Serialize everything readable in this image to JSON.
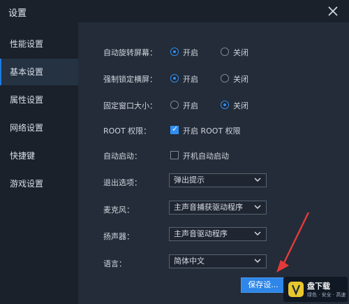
{
  "window": {
    "title": "设置"
  },
  "sidebar": {
    "items": [
      {
        "label": "性能设置"
      },
      {
        "label": "基本设置"
      },
      {
        "label": "属性设置"
      },
      {
        "label": "网络设置"
      },
      {
        "label": "快捷键"
      },
      {
        "label": "游戏设置"
      }
    ],
    "active_index": 1
  },
  "settings": {
    "auto_rotate": {
      "label": "自动旋转屏幕：",
      "on": "开启",
      "off": "关闭",
      "value": "on"
    },
    "force_landscape": {
      "label": "强制锁定横屏：",
      "on": "开启",
      "off": "关闭",
      "value": "on"
    },
    "fixed_window": {
      "label": "固定窗口大小：",
      "on": "开启",
      "off": "关闭",
      "value": "off"
    },
    "root": {
      "label": "ROOT 权限：",
      "option": "开启 ROOT 权限",
      "checked": true
    },
    "autostart": {
      "label": "自动启动：",
      "option": "开机自动启动",
      "checked": false
    },
    "exit_option": {
      "label": "退出选项：",
      "value": "弹出提示"
    },
    "mic": {
      "label": "麦克风：",
      "value": "主声音捕获驱动程序"
    },
    "speaker": {
      "label": "扬声器：",
      "value": "主声音驱动程序"
    },
    "language": {
      "label": "语言：",
      "value": "简体中文"
    }
  },
  "actions": {
    "save_label": "保存设..."
  },
  "watermark": {
    "title": "盘下载",
    "subtitle": "绿色 · 安全 · 高速"
  },
  "colors": {
    "accent": "#2e86e8",
    "sidebar_bg": "#1a212b",
    "main_bg": "#232c38",
    "arrow": "#e23a3a"
  }
}
